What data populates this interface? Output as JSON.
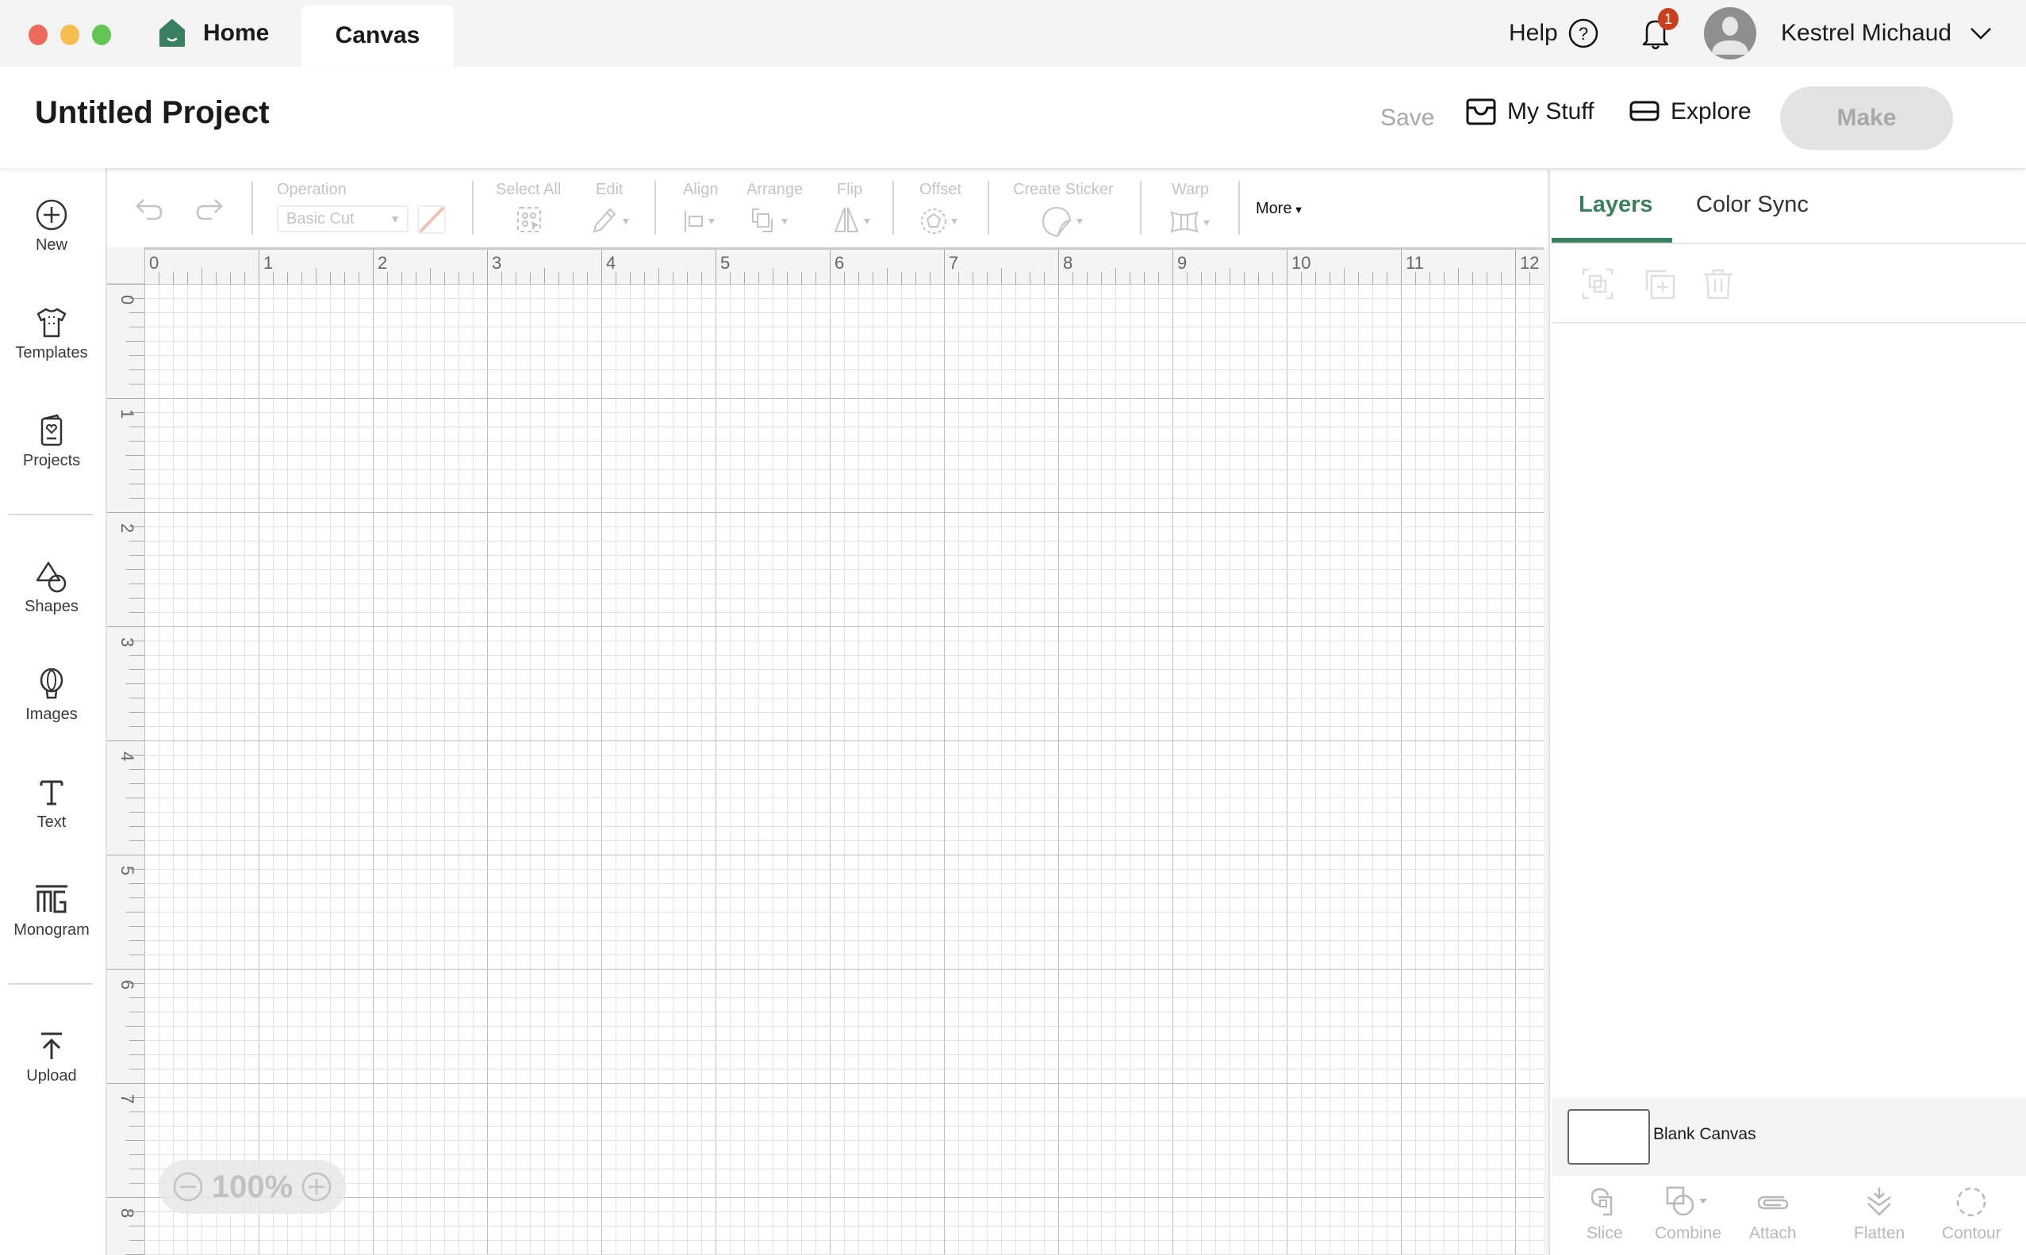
{
  "window": {
    "traffic_lights": [
      "#ee6a5f",
      "#f5be4f",
      "#62c554"
    ],
    "tabs": [
      {
        "label": "Home",
        "icon": "home-icon",
        "active": false
      },
      {
        "label": "Canvas",
        "active": true
      }
    ],
    "help_label": "Help",
    "notifications_count": "1",
    "user_name": "Kestrel Michaud"
  },
  "header": {
    "project_title": "Untitled Project",
    "save_label": "Save",
    "my_stuff_label": "My Stuff",
    "explore_label": "Explore",
    "make_label": "Make"
  },
  "sidebar": {
    "items": [
      {
        "label": "New",
        "icon": "plus-circle-icon"
      },
      {
        "label": "Templates",
        "icon": "tshirt-icon"
      },
      {
        "label": "Projects",
        "icon": "card-heart-icon"
      },
      {
        "label": "Shapes",
        "icon": "shapes-icon"
      },
      {
        "label": "Images",
        "icon": "balloon-icon"
      },
      {
        "label": "Text",
        "icon": "text-icon"
      },
      {
        "label": "Monogram",
        "icon": "monogram-icon"
      },
      {
        "label": "Upload",
        "icon": "upload-icon"
      }
    ]
  },
  "toolbar": {
    "operation_label": "Operation",
    "operation_value": "Basic Cut",
    "select_all_label": "Select All",
    "edit_label": "Edit",
    "align_label": "Align",
    "arrange_label": "Arrange",
    "flip_label": "Flip",
    "offset_label": "Offset",
    "create_sticker_label": "Create Sticker",
    "warp_label": "Warp",
    "more_label": "More"
  },
  "canvas": {
    "ruler_top": [
      "0",
      "1",
      "2",
      "3",
      "4",
      "5",
      "6",
      "7",
      "8",
      "9",
      "10",
      "11",
      "12"
    ],
    "ruler_left": [
      "0",
      "1",
      "2",
      "3",
      "4",
      "5",
      "6",
      "7",
      "8"
    ],
    "zoom_level": "100%"
  },
  "right_panel": {
    "tabs": [
      {
        "label": "Layers",
        "active": true
      },
      {
        "label": "Color Sync",
        "active": false
      }
    ],
    "accent_color": "#3a7f5f",
    "layers": [
      {
        "name": "Blank Canvas"
      }
    ],
    "bottom_tools": [
      {
        "label": "Slice",
        "icon": "slice-icon"
      },
      {
        "label": "Combine",
        "icon": "combine-icon"
      },
      {
        "label": "Attach",
        "icon": "attach-icon"
      },
      {
        "label": "Flatten",
        "icon": "flatten-icon"
      },
      {
        "label": "Contour",
        "icon": "contour-icon"
      }
    ]
  }
}
